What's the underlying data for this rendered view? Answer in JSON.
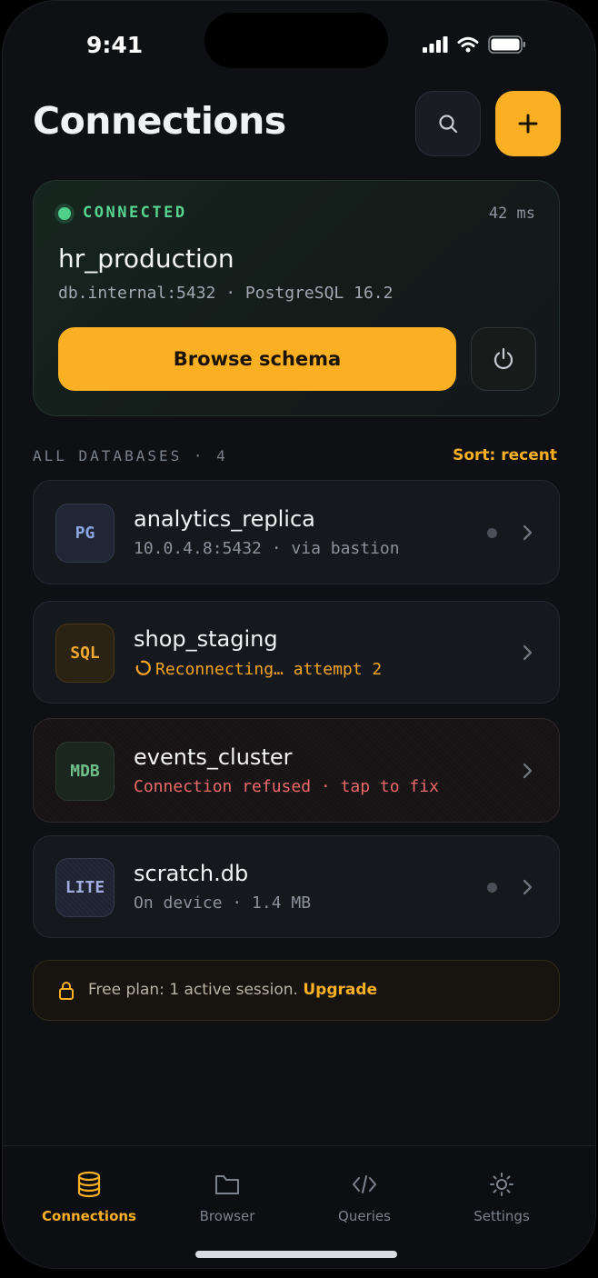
{
  "status_bar": {
    "time": "9:41"
  },
  "header": {
    "title": "Connections"
  },
  "active_connection": {
    "status": "CONNECTED",
    "latency": "42 ms",
    "name": "hr_production",
    "host": "db.internal:5432 · PostgreSQL 16.2",
    "browse_label": "Browse schema",
    "status_color": "#57d48f"
  },
  "section": {
    "label": "ALL DATABASES · 4",
    "sort_label": "Sort: recent"
  },
  "databases": [
    {
      "badge": "PG",
      "name": "analytics_replica",
      "subtitle": "10.0.4.8:5432 · via bastion"
    },
    {
      "badge": "SQL",
      "name": "shop_staging",
      "subtitle": "Reconnecting… attempt 2"
    },
    {
      "badge": "MDB",
      "name": "events_cluster",
      "subtitle": "Connection refused · tap to fix"
    },
    {
      "badge": "LITE",
      "name": "scratch.db",
      "subtitle": "On device · 1.4 MB"
    }
  ],
  "plan": {
    "text": "Free plan: 1 active session.",
    "link": "Upgrade"
  },
  "tabs": [
    {
      "label": "Connections",
      "icon": "database-icon"
    },
    {
      "label": "Browser",
      "icon": "folder-icon"
    },
    {
      "label": "Queries",
      "icon": "code-icon"
    },
    {
      "label": "Settings",
      "icon": "gear-icon"
    }
  ],
  "colors": {
    "accent": "#fbb024",
    "success": "#57d48f",
    "warning": "#f5a524",
    "error": "#ee6a6a",
    "background": "#0e1014"
  }
}
